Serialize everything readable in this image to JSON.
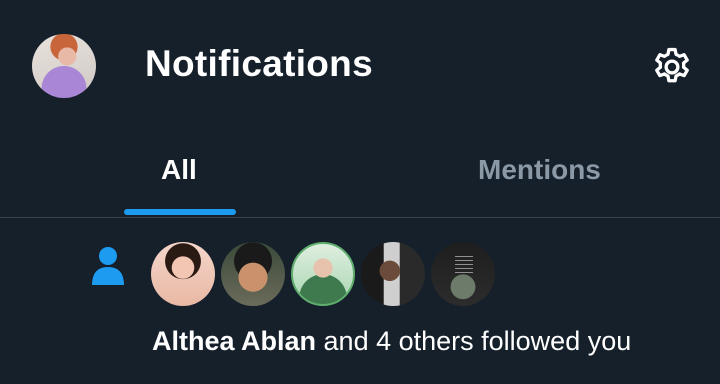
{
  "header": {
    "title": "Notifications",
    "avatar_alt": "Profile avatar",
    "settings_icon": "gear-icon"
  },
  "tabs": [
    {
      "label": "All",
      "active": true
    },
    {
      "label": "Mentions",
      "active": false
    }
  ],
  "colors": {
    "background": "#15202b",
    "accent": "#1d9bf0",
    "muted_text": "#8b98a5",
    "divider": "#38444d"
  },
  "notification": {
    "icon": "person-icon",
    "follower_avatars": [
      "follower-1",
      "follower-2",
      "follower-3",
      "follower-4",
      "follower-5"
    ],
    "name": "Althea Ablan",
    "rest": " and 4 others followed you"
  }
}
